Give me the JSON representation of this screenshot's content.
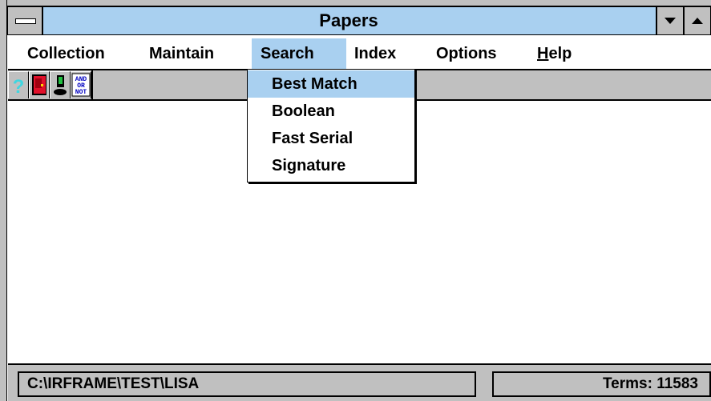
{
  "window": {
    "title": "Papers"
  },
  "menubar": {
    "items": [
      {
        "label": "Collection"
      },
      {
        "label": "Maintain"
      },
      {
        "label": "Search"
      },
      {
        "label": "Index"
      },
      {
        "label": "Options"
      },
      {
        "label_rest": "elp",
        "accel": "H"
      }
    ]
  },
  "toolbar": {
    "bool_icon_text": "AND\nOR\nNOT"
  },
  "search_menu": {
    "items": [
      {
        "label": "Best Match"
      },
      {
        "label": "Boolean"
      },
      {
        "label": "Fast Serial"
      },
      {
        "label": "Signature"
      }
    ]
  },
  "status": {
    "path": "C:\\IRFRAME\\TEST\\LISA",
    "terms": "Terms: 11583"
  },
  "colors": {
    "highlight": "#a9d0f0",
    "frame": "#c0c0c0"
  }
}
